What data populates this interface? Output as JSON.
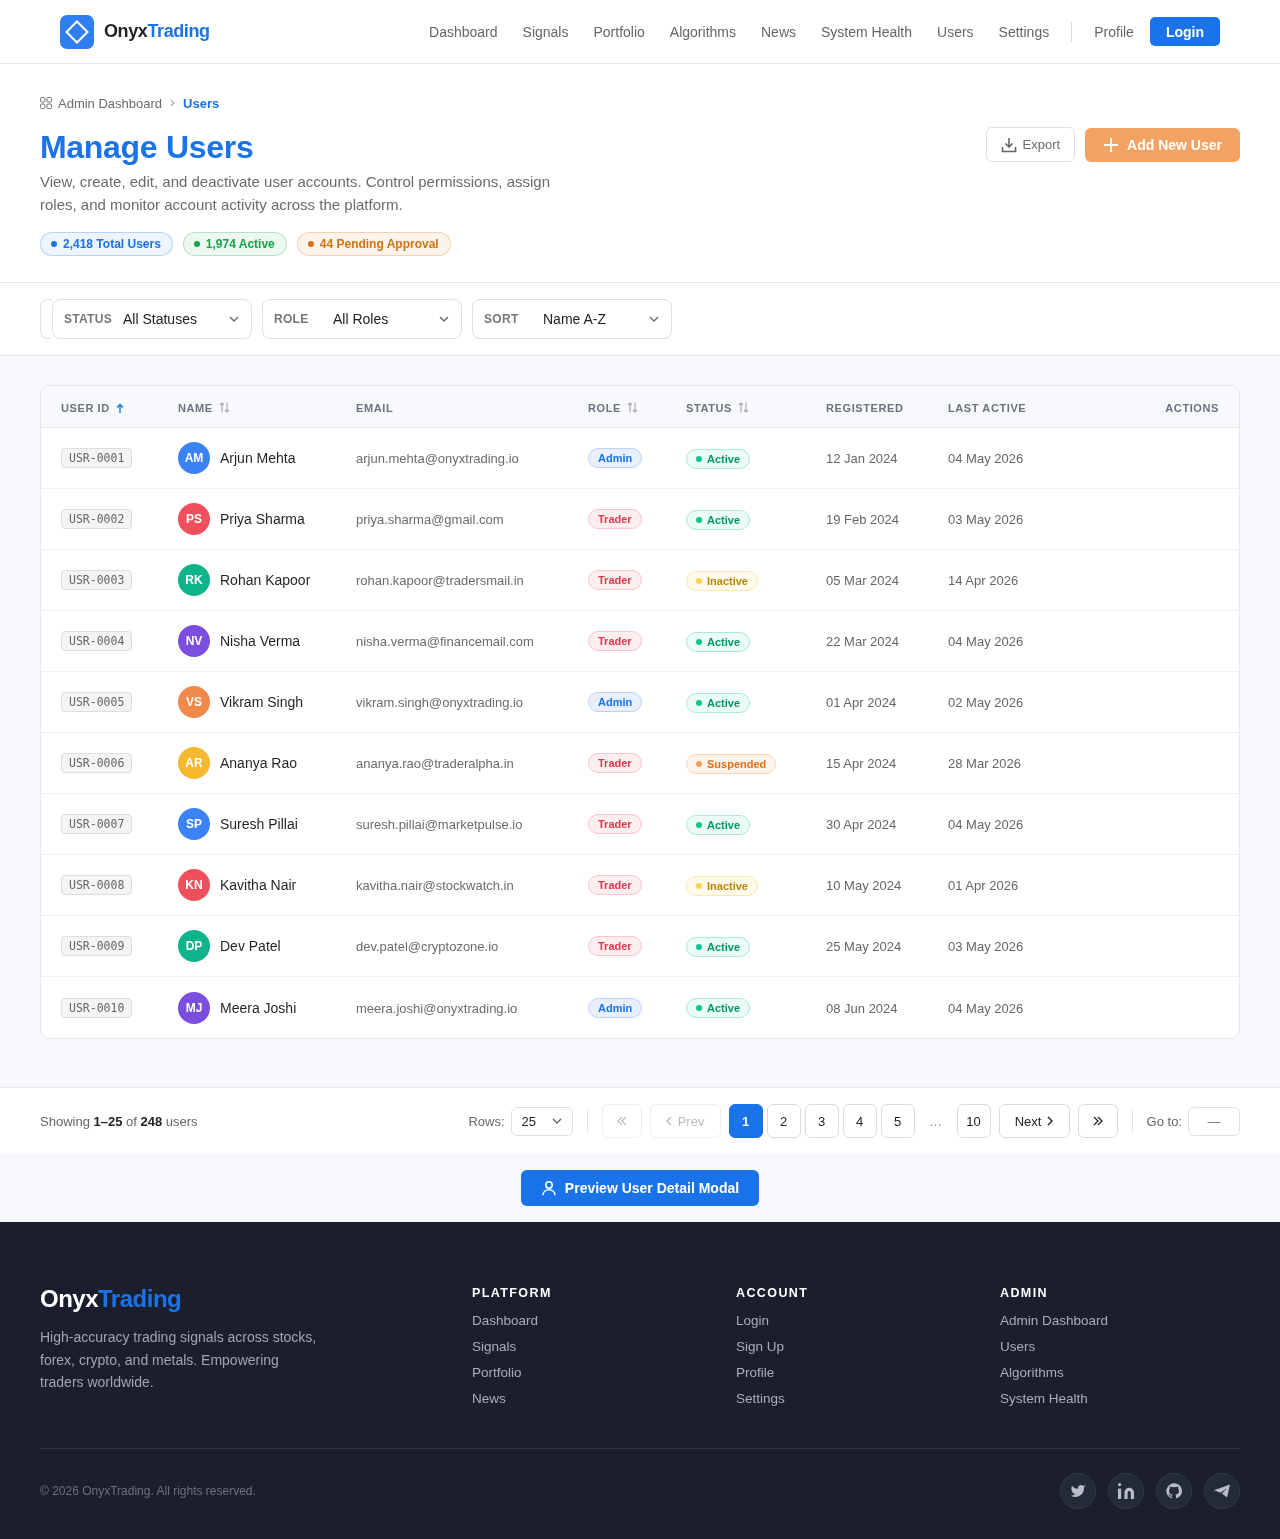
{
  "header": {
    "logo": {
      "first": "Onyx",
      "second": "Trading"
    },
    "nav": [
      "Dashboard",
      "Signals",
      "Portfolio",
      "Algorithms",
      "News",
      "System Health",
      "Users",
      "Settings"
    ],
    "profile": "Profile",
    "login": "Login"
  },
  "page_header": {
    "breadcrumb": [
      {
        "label": "Admin Dashboard",
        "current": false
      },
      {
        "label": "Users",
        "current": true
      }
    ],
    "title": "Manage Users",
    "description": "View, create, edit, and deactivate user accounts. Control permissions, assign roles, and monitor account activity across the platform.",
    "stats": [
      {
        "label": "2,418 Total Users",
        "color": "#1a73e8"
      },
      {
        "label": "1,974 Active",
        "color": "#16a34a"
      },
      {
        "label": "44 Pending Approval",
        "color": "#d4720c"
      }
    ],
    "actions": [
      {
        "label": "Export",
        "kind": "secondary"
      },
      {
        "label": "Add New User",
        "kind": "primary"
      }
    ]
  },
  "filters": [
    {
      "label": "STATUS",
      "value": "All Statuses"
    },
    {
      "label": "ROLE",
      "value": "All Roles"
    },
    {
      "label": "SORT",
      "value": "Name A-Z"
    }
  ],
  "table": {
    "columns": [
      {
        "label": "USER ID",
        "sortable": true,
        "sorted": true
      },
      {
        "label": "NAME",
        "sortable": true,
        "sorted": false
      },
      {
        "label": "EMAIL",
        "sortable": false
      },
      {
        "label": "ROLE",
        "sortable": true,
        "sorted": false
      },
      {
        "label": "STATUS",
        "sortable": true,
        "sorted": false
      },
      {
        "label": "REGISTERED",
        "sortable": false
      },
      {
        "label": "LAST ACTIVE",
        "sortable": false
      },
      {
        "label": "ACTIONS",
        "sortable": false
      }
    ],
    "rows": [
      {
        "id": "USR-0001",
        "initials": "AM",
        "color": "#3b82f6",
        "name": "Arjun Mehta",
        "email": "arjun.mehta@onyxtrading.io",
        "role": {
          "label": "Admin",
          "kind": "admin"
        },
        "status": {
          "label": "Active",
          "kind": "active"
        },
        "registered": "12 Jan 2024",
        "last_active": "04 May 2026"
      },
      {
        "id": "USR-0002",
        "initials": "PS",
        "color": "#f0505e",
        "name": "Priya Sharma",
        "email": "priya.sharma@gmail.com",
        "role": {
          "label": "Trader",
          "kind": "trader"
        },
        "status": {
          "label": "Active",
          "kind": "active"
        },
        "registered": "19 Feb 2024",
        "last_active": "03 May 2026"
      },
      {
        "id": "USR-0003",
        "initials": "RK",
        "color": "#10b48a",
        "name": "Rohan Kapoor",
        "email": "rohan.kapoor@tradersmail.in",
        "role": {
          "label": "Trader",
          "kind": "trader"
        },
        "status": {
          "label": "Inactive",
          "kind": "inactive"
        },
        "registered": "05 Mar 2024",
        "last_active": "14 Apr 2026"
      },
      {
        "id": "USR-0004",
        "initials": "NV",
        "color": "#7c4ee0",
        "name": "Nisha Verma",
        "email": "nisha.verma@financemail.com",
        "role": {
          "label": "Trader",
          "kind": "trader"
        },
        "status": {
          "label": "Active",
          "kind": "active"
        },
        "registered": "22 Mar 2024",
        "last_active": "04 May 2026"
      },
      {
        "id": "USR-0005",
        "initials": "VS",
        "color": "#f08a4b",
        "name": "Vikram Singh",
        "email": "vikram.singh@onyxtrading.io",
        "role": {
          "label": "Admin",
          "kind": "admin"
        },
        "status": {
          "label": "Active",
          "kind": "active"
        },
        "registered": "01 Apr 2024",
        "last_active": "02 May 2026"
      },
      {
        "id": "USR-0006",
        "initials": "AR",
        "color": "#f5b82e",
        "name": "Ananya Rao",
        "email": "ananya.rao@traderalpha.in",
        "role": {
          "label": "Trader",
          "kind": "trader"
        },
        "status": {
          "label": "Suspended",
          "kind": "suspended"
        },
        "registered": "15 Apr 2024",
        "last_active": "28 Mar 2026"
      },
      {
        "id": "USR-0007",
        "initials": "SP",
        "color": "#3b82f6",
        "name": "Suresh Pillai",
        "email": "suresh.pillai@marketpulse.io",
        "role": {
          "label": "Trader",
          "kind": "trader"
        },
        "status": {
          "label": "Active",
          "kind": "active"
        },
        "registered": "30 Apr 2024",
        "last_active": "04 May 2026"
      },
      {
        "id": "USR-0008",
        "initials": "KN",
        "color": "#f0505e",
        "name": "Kavitha Nair",
        "email": "kavitha.nair@stockwatch.in",
        "role": {
          "label": "Trader",
          "kind": "trader"
        },
        "status": {
          "label": "Inactive",
          "kind": "inactive"
        },
        "registered": "10 May 2024",
        "last_active": "01 Apr 2026"
      },
      {
        "id": "USR-0009",
        "initials": "DP",
        "color": "#10b48a",
        "name": "Dev Patel",
        "email": "dev.patel@cryptozone.io",
        "role": {
          "label": "Trader",
          "kind": "trader"
        },
        "status": {
          "label": "Active",
          "kind": "active"
        },
        "registered": "25 May 2024",
        "last_active": "03 May 2026"
      },
      {
        "id": "USR-0010",
        "initials": "MJ",
        "color": "#7c4ee0",
        "name": "Meera Joshi",
        "email": "meera.joshi@onyxtrading.io",
        "role": {
          "label": "Admin",
          "kind": "admin"
        },
        "status": {
          "label": "Active",
          "kind": "active"
        },
        "registered": "08 Jun 2024",
        "last_active": "04 May 2026"
      }
    ]
  },
  "pagination": {
    "summary": "Showing **1–25** of **248** users",
    "rows_label": "Rows:",
    "rows_value": "25",
    "first": {
      "disabled": true
    },
    "prev": {
      "label": "Prev",
      "disabled": true
    },
    "pages": [
      {
        "label": "1",
        "kind": "page",
        "selected": true
      },
      {
        "label": "2",
        "kind": "page",
        "selected": false
      },
      {
        "label": "3",
        "kind": "page",
        "selected": false
      },
      {
        "label": "4",
        "kind": "page",
        "selected": false
      },
      {
        "label": "5",
        "kind": "page",
        "selected": false
      },
      {
        "label": "…",
        "kind": "ellipsis",
        "selected": false
      },
      {
        "label": "10",
        "kind": "page",
        "selected": false
      }
    ],
    "next": {
      "label": "Next",
      "disabled": false
    },
    "last": {
      "disabled": false
    },
    "goto_label": "Go to:",
    "goto_placeholder": "—"
  },
  "preview_button": "Preview User Detail Modal",
  "footer": {
    "logo": {
      "first": "Onyx",
      "second": "Trading"
    },
    "tagline": "High-accuracy trading signals across stocks, forex, crypto, and metals. Empowering traders worldwide.",
    "columns": [
      {
        "title": "PLATFORM",
        "links": [
          "Dashboard",
          "Signals",
          "Portfolio",
          "News"
        ]
      },
      {
        "title": "ACCOUNT",
        "links": [
          "Login",
          "Sign Up",
          "Profile",
          "Settings"
        ]
      },
      {
        "title": "ADMIN",
        "links": [
          "Admin Dashboard",
          "Users",
          "Algorithms",
          "System Health"
        ]
      }
    ],
    "copyright": "© 2026 OnyxTrading. All rights reserved."
  }
}
